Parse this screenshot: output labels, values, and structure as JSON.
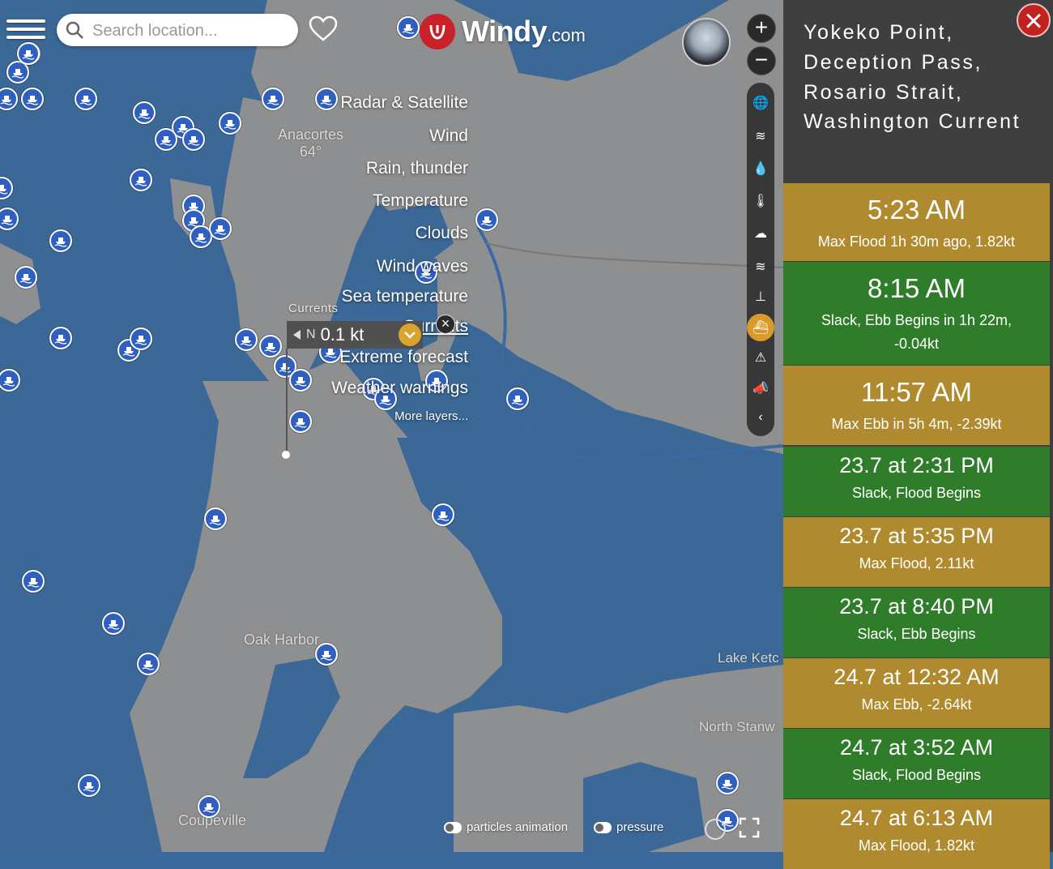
{
  "search": {
    "placeholder": "Search location..."
  },
  "logo": {
    "word": "Windy",
    "suffix": "com"
  },
  "map": {
    "places": [
      {
        "name": "Anacortes",
        "temp": "64°"
      },
      {
        "name": "Oak Harbor",
        "temp": ""
      },
      {
        "name": "Coupeville",
        "temp": ""
      },
      {
        "name": "Lake Ketc",
        "temp": ""
      },
      {
        "name": "North Stanw",
        "temp": ""
      }
    ]
  },
  "layers": [
    {
      "label": "Radar & Satellite",
      "icon": "globe-icon"
    },
    {
      "label": "Wind",
      "icon": "wind-icon"
    },
    {
      "label": "Rain, thunder",
      "icon": "raindrop-icon"
    },
    {
      "label": "Temperature",
      "icon": "thermometer-icon"
    },
    {
      "label": "Clouds",
      "icon": "cloud-icon"
    },
    {
      "label": "Wind waves",
      "icon": "waves-icon"
    },
    {
      "label": "Sea temperature",
      "icon": "sea-temp-icon"
    },
    {
      "label": "Currents",
      "icon": "currents-icon",
      "active": true
    },
    {
      "label": "Extreme forecast",
      "icon": "warning-icon"
    },
    {
      "label": "Weather warnings",
      "icon": "megaphone-icon"
    },
    {
      "label": "More layers...",
      "icon": "chevron-left-icon"
    }
  ],
  "currents_picker": {
    "label": "Currents",
    "direction": "N",
    "value": "0.1 kt"
  },
  "toggles": {
    "particles": "particles animation",
    "pressure": "pressure"
  },
  "panel": {
    "title": "Yokeko Point, Deception Pass, Rosario Strait, Washington Current",
    "entries": [
      {
        "time": "5:23 AM",
        "desc": "Max Flood 1h 30m ago, 1.82kt",
        "type": "max"
      },
      {
        "time": "8:15 AM",
        "desc": "Slack, Ebb Begins in 1h 22m, -0.04kt",
        "type": "slack"
      },
      {
        "time": "11:57 AM",
        "desc": "Max Ebb in 5h 4m, -2.39kt",
        "type": "max"
      },
      {
        "time": "23.7 at 2:31 PM",
        "desc": "Slack, Flood Begins",
        "type": "slack"
      },
      {
        "time": "23.7 at 5:35 PM",
        "desc": "Max Flood, 2.11kt",
        "type": "max"
      },
      {
        "time": "23.7 at 8:40 PM",
        "desc": "Slack, Ebb Begins",
        "type": "slack"
      },
      {
        "time": "24.7 at 12:32 AM",
        "desc": "Max Ebb, -2.64kt",
        "type": "max"
      },
      {
        "time": "24.7 at 3:52 AM",
        "desc": "Slack, Flood Begins",
        "type": "slack"
      },
      {
        "time": "24.7 at 6:13 AM",
        "desc": "Max Flood, 1.82kt",
        "type": "max"
      }
    ]
  },
  "colors": {
    "max": "#b08a2e",
    "slack": "#2f7d2a",
    "water": "#3b6896",
    "land": "#8a8c8e",
    "accent": "#d9a32d"
  }
}
